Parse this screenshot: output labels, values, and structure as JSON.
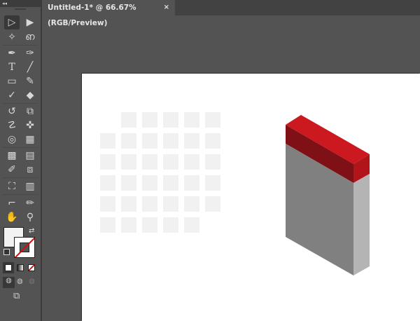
{
  "toolbar": {
    "collapse_label": "◂◂",
    "tools": [
      "selection",
      "direct-selection",
      "magic-wand",
      "lasso",
      "pen",
      "curvature",
      "type",
      "line-segment",
      "rectangle",
      "paintbrush",
      "shaper",
      "eraser",
      "rotate",
      "scale",
      "warp",
      "puppet-warp",
      "shape-builder",
      "perspective-grid",
      "mesh",
      "gradient",
      "eyedropper",
      "blend",
      "symbol-sprayer",
      "column-graph",
      "artboard",
      "slice",
      "hand",
      "zoom"
    ]
  },
  "document": {
    "tab_title": "Untitled-1* @ 66.67% (RGB/Preview)",
    "close_label": "×"
  },
  "colors": {
    "canvas": "#535353",
    "artboard": "#ffffff",
    "square": "#f1f1f1",
    "red_top": "#cc1920",
    "red_front": "#7f1015",
    "red_side": "#b2141b",
    "gray_front": "#808080",
    "gray_side": "#b4b4b4"
  },
  "grid": {
    "rows": [
      [
        1,
        2,
        3,
        4,
        5
      ],
      [
        0,
        1,
        2,
        3,
        4,
        5
      ],
      [
        0,
        1,
        2,
        3,
        4,
        5
      ],
      [
        0,
        1,
        2,
        3,
        4,
        5
      ],
      [
        0,
        1,
        2,
        3,
        4,
        5
      ],
      [
        0,
        1,
        2,
        3,
        4
      ]
    ]
  }
}
